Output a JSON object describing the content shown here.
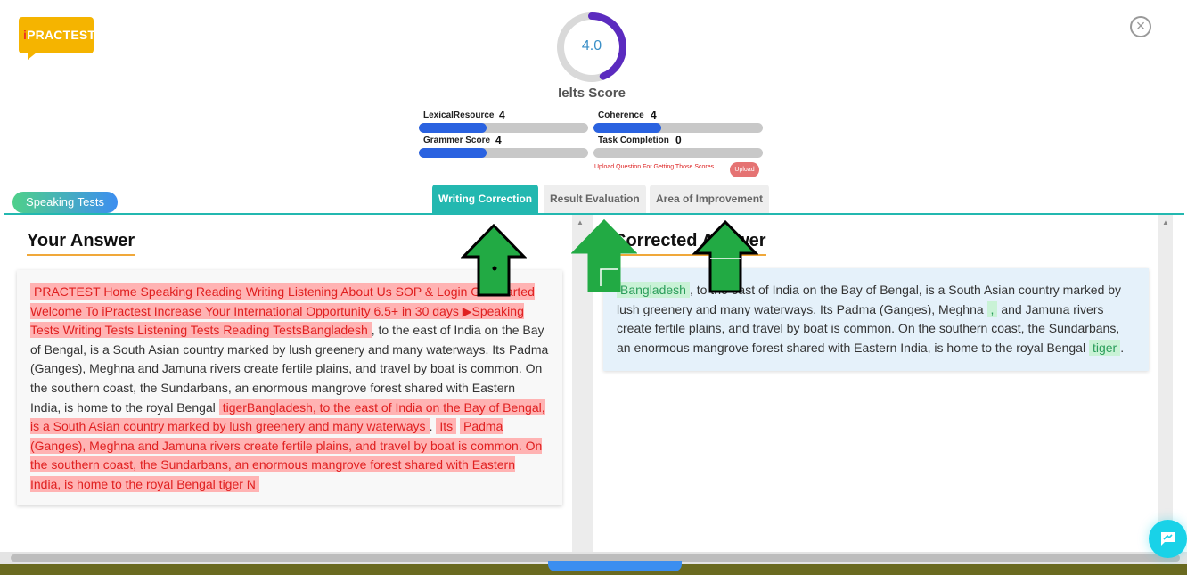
{
  "logo": {
    "prefix": "i",
    "text": "PRACTEST"
  },
  "score": {
    "value": "4.0",
    "label": "Ielts Score",
    "fraction": 0.44
  },
  "metrics": [
    {
      "name": "LexicalResource",
      "value": "4",
      "fraction": 0.4
    },
    {
      "name": "Coherence",
      "value": "4",
      "fraction": 0.4
    },
    {
      "name": "Grammer Score",
      "value": "4",
      "fraction": 0.4
    },
    {
      "name": "Task Completion",
      "value": "0",
      "fraction": 0.0
    }
  ],
  "upload": {
    "note": "Upload Question For Getting Those Scores",
    "button": "Upload"
  },
  "speaking_tests": "Speaking Tests",
  "tabs": [
    {
      "label": "Writing Correction",
      "active": true
    },
    {
      "label": "Result Evaluation",
      "active": false
    },
    {
      "label": "Area of Improvement",
      "active": false
    }
  ],
  "left_panel": {
    "title": "Your Answer",
    "err1": "PRACTEST Home Speaking Reading Writing Listening About Us SOP & Login Get Started Welcome To iPractest Increase Your International Opportunity 6.5+ in 30 days ▶Speaking Tests Writing Tests Listening Tests Reading TestsBangladesh",
    "text1": ", to the east of India on the Bay of Bengal, is a South Asian country marked by lush greenery and many waterways. Its Padma (Ganges), Meghna and Jamuna rivers create fertile plains, and travel by boat is common. On the southern coast, the Sundarbans, an enormous mangrove forest shared with Eastern India, is home to the royal Bengal",
    "err2": "tigerBangladesh, to the east of India on the Bay of Bengal, is a South Asian country marked by lush greenery and many waterways",
    "text2": ".",
    "err3": "Its",
    "err4": "Padma (Ganges), Meghna and Jamuna rivers create fertile plains, and travel by boat is common. On the southern coast, the Sundarbans, an enormous mangrove forest shared with Eastern India, is home to the royal Bengal tiger N"
  },
  "right_panel": {
    "title": "Corrected Answer",
    "ok1": "Bangladesh",
    "text1": ", to the east of India on the Bay of Bengal, is a South Asian country marked by lush greenery and many waterways. Its Padma (Ganges), Meghna",
    "ok2": ",",
    "text2": "and Jamuna rivers create fertile plains, and travel by boat is common. On the southern coast, the Sundarbans, an enormous mangrove forest shared with Eastern India, is home to the royal Bengal",
    "ok3": "tiger",
    "text3": "."
  },
  "colors": {
    "accent": "#23b8b0",
    "bar_fill": "#2a62e0",
    "error_bg": "#ffb3b3",
    "error_text": "#e02020",
    "correct_bg": "#c9f2d6",
    "correct_text": "#2a9d5a",
    "logo": "#f5b400",
    "ring": "#5b2bbf",
    "arrow_green": "#22aa44"
  },
  "icons": {
    "close": "close-circle-icon",
    "chat": "chat-icon",
    "arrow": "up-arrow-icon"
  }
}
